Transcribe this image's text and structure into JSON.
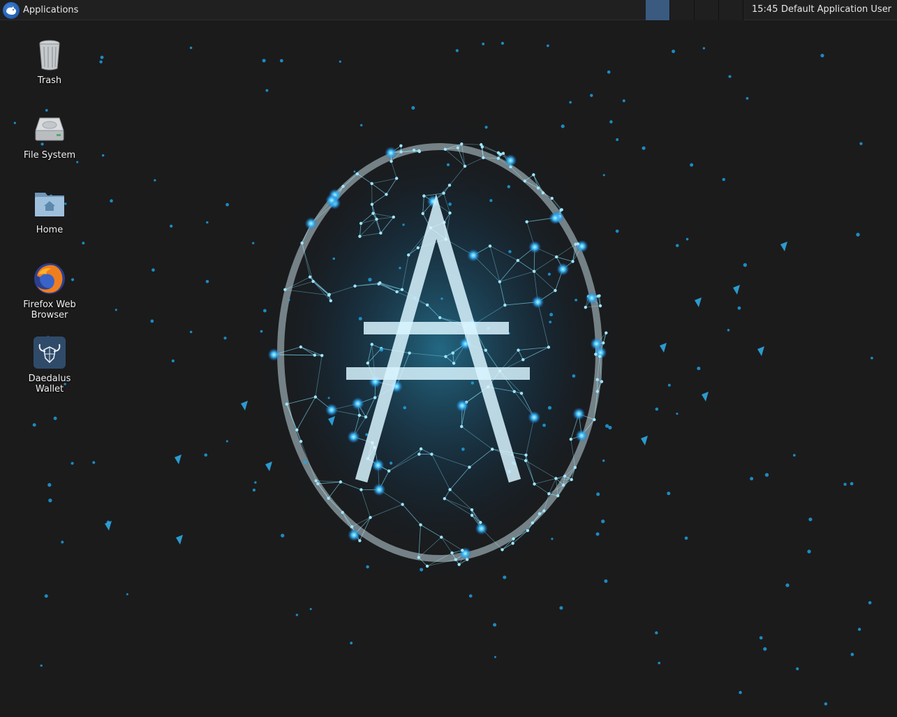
{
  "panel": {
    "app_menu_label": "Applications",
    "clock": "15:45",
    "user": "Default Application User",
    "workspaces": 4,
    "active_workspace": 1
  },
  "desktop": {
    "icons": [
      {
        "label": "Trash",
        "icon": "trash-icon"
      },
      {
        "label": "File System",
        "icon": "drive-icon"
      },
      {
        "label": "Home",
        "icon": "home-folder-icon"
      },
      {
        "label": "Firefox Web Browser",
        "icon": "firefox-icon"
      },
      {
        "label": "Daedalus Wallet",
        "icon": "daedalus-icon"
      }
    ]
  },
  "wallpaper": {
    "description_icon": "cardano-network-logo",
    "accent": "#1ea7e8",
    "background": "#1b1b1c"
  }
}
